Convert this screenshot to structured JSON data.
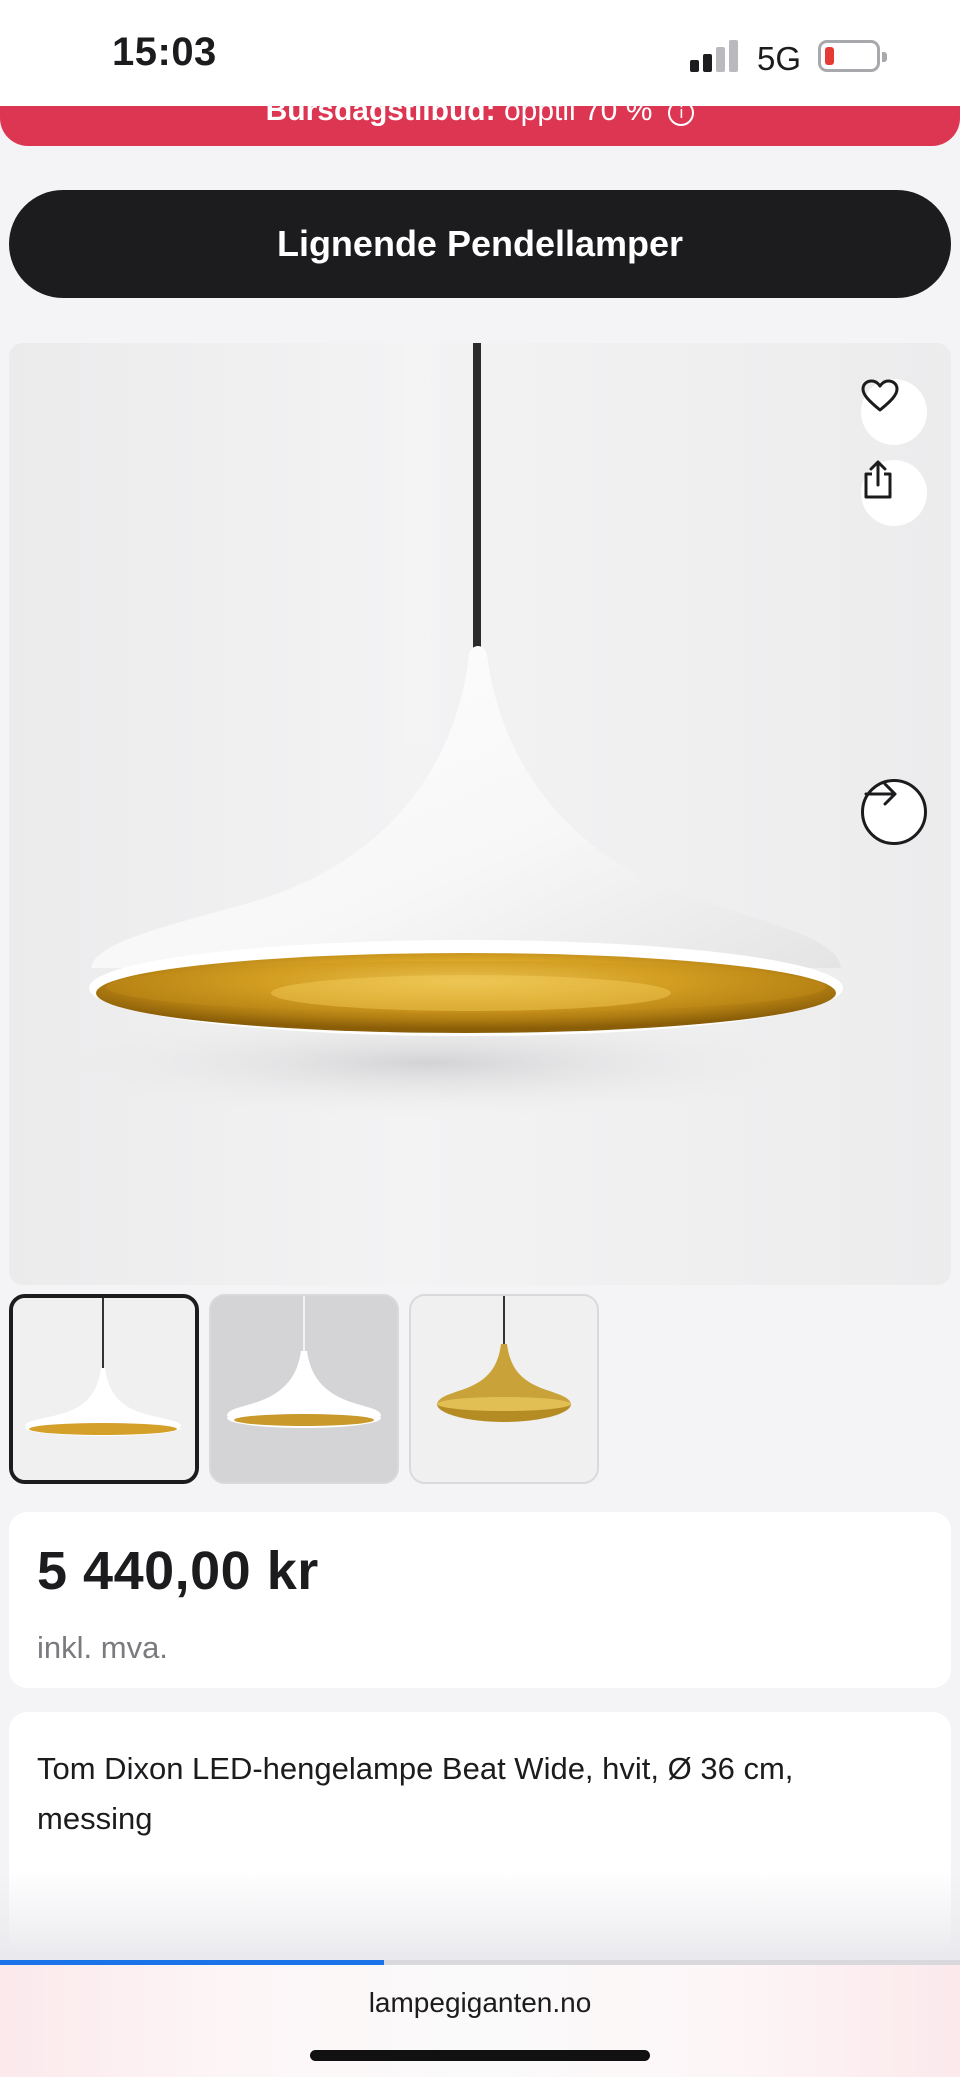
{
  "status_bar": {
    "time": "15:03",
    "network": "5G",
    "icons": [
      "signal-icon",
      "battery-icon"
    ],
    "battery_color": "#e53935"
  },
  "promo": {
    "bold": "Bursdagstilbud:",
    "text": " opptil 70 %",
    "icon": "info-icon",
    "color": "#dc3652"
  },
  "similar_button": {
    "label": "Lignende Pendellamper"
  },
  "gallery": {
    "icons": [
      "heart-icon",
      "share-icon",
      "arrow-right-icon"
    ],
    "thumbnail_count": 3,
    "selected_thumbnail": 1
  },
  "product": {
    "price": "5 440,00 kr",
    "vat_note": "inkl. mva.",
    "title": "Tom Dixon LED-hengelampe Beat Wide, hvit, Ø 36 cm, messing"
  },
  "browser": {
    "url": "lampegiganten.no",
    "load_progress": 0.4,
    "accent": "#1a73e8"
  }
}
